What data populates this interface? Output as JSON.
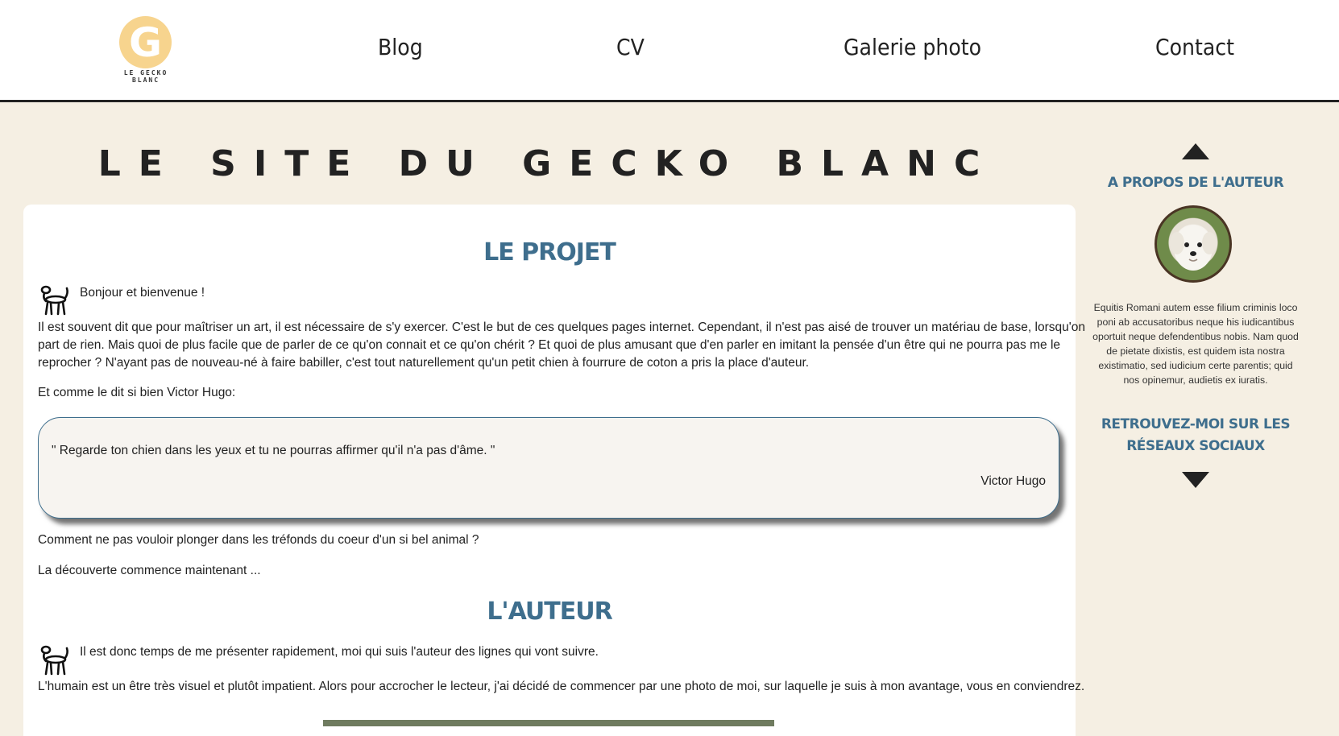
{
  "header": {
    "logo_letter": "G",
    "logo_text": "LE GECKO BLANC",
    "nav": [
      "Blog",
      "CV",
      "Galerie photo",
      "Contact"
    ]
  },
  "site_title": "LE SITE DU GECKO BLANC",
  "project": {
    "title": "LE PROJET",
    "greeting": "Bonjour et bienvenue !",
    "paragraph": "Il est souvent dit que pour maîtriser un art, il est nécessaire de s'y exercer. C'est le but de ces quelques pages internet. Cependant, il n'est pas aisé de trouver un matériau de base, lorsqu'on part de rien. Mais quoi de plus facile que de parler de ce qu'on connait et ce qu'on chérit ? Et quoi de plus amusant que d'en parler en imitant la pensée d'un être qui ne pourra pas me le reprocher ? N'ayant pas de nouveau-né à faire babiller, c'est tout naturellement qu'un petit chien à fourrure de coton a pris la place d'auteur.",
    "intro_quote": "Et comme le dit si bien Victor Hugo:",
    "quote": "\" Regarde ton chien dans les yeux et tu ne pourras affirmer qu'il n'a pas d'âme. \"",
    "quote_author": "Victor Hugo",
    "after_quote_1": "Comment ne pas vouloir plonger dans les tréfonds du coeur d'un si bel animal ?",
    "after_quote_2": "La découverte commence maintenant ..."
  },
  "author": {
    "title": "L'AUTEUR",
    "intro": "Il est donc temps de me présenter rapidement, moi qui suis l'auteur des lignes qui vont suivre.",
    "paragraph": "L'humain est un être très visuel et plutôt impatient. Alors pour accrocher le lecteur, j'ai décidé de commencer par une photo de moi, sur laquelle je suis à mon avantage, vous en conviendrez."
  },
  "sidebar": {
    "about_heading": "A PROPOS DE L'AUTEUR",
    "about_text": "Equitis Romani autem esse filium criminis loco poni ab accusatoribus neque his iudicantibus oportuit neque defendentibus nobis. Nam quod de pietate dixistis, est quidem ista nostra existimatio, sed iudicium certe parentis; quid nos opinemur, audietis ex iuratis.",
    "social_heading_line1": "RETROUVEZ-MOI SUR LES",
    "social_heading_line2": "RÉSEAUX SOCIAUX"
  },
  "colors": {
    "background": "#f5efe3",
    "accent": "#3e6e8d",
    "logo": "#f7d48e"
  },
  "icons": [
    "balloon-dog-icon",
    "arrow-up-icon",
    "arrow-down-icon"
  ]
}
